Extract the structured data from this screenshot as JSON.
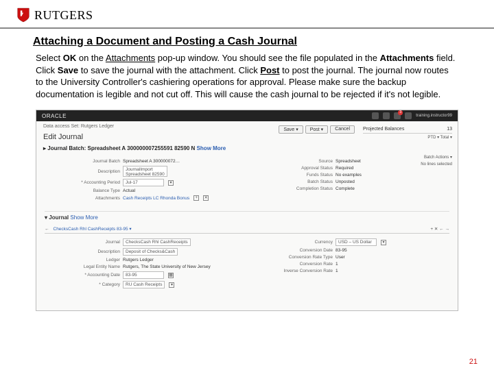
{
  "logo_text": "RUTGERS",
  "section_title": "Attaching a Document and Posting a Cash Journal",
  "p_pre1": "Select ",
  "p_ok": "OK",
  "p_mid1": " on the ",
  "p_attachments1": "Attachments",
  "p_mid2": " pop-up window. You should see the file populated in the ",
  "p_attachments2": "Attachments",
  "p_mid3": " field. Click ",
  "p_save": "Save",
  "p_mid4": " to save the journal with the attachment. Click ",
  "p_post": "Post",
  "p_after": " to post the journal. The journal now routes to the University Controller's cashiering operations for approval. Please make sure the backup documentation is legible and not cut off. This will cause the cash journal to be rejected if it's not legible.",
  "page_num": "21",
  "shot": {
    "brand": "ORACLE",
    "badge": "3",
    "user": "training.instructor99",
    "crumb": "Data access Set: Rutgers Ledger",
    "edit_title": "Edit Journal",
    "batch": "Journal Batch: Spreadsheet A 300000007255591 82590 N",
    "show_more": "Show More",
    "btn_save": "Save ▾",
    "btn_post": "Post ▾",
    "btn_cancel": "Cancel",
    "rp_title": "Projected Balances",
    "rp_count": "13",
    "rp_line1": "PTD ▾  Total ▾",
    "rp_batch_act": "Batch Actions ▾",
    "rp_no_lines": "No lines selected",
    "form": {
      "jb_label": "Journal Batch",
      "jb_value": "Spreadsheet A 300000072…",
      "desc_label": "Description",
      "desc_value": "JournalImport\nSpreadsheet 82590",
      "ap_label": "* Accounting Period",
      "ap_value": "Jul-17",
      "bt_label": "Balance Type",
      "bt_value": "Actual",
      "att_label": "Attachments",
      "att_value": "Cash Receipts LC Rhonda Bonus",
      "src_label": "Source",
      "src_value": "Spreadsheet",
      "appr_label": "Approval Status",
      "appr_value": "Required",
      "funds_label": "Funds Status",
      "funds_value": "No examples",
      "bs_label": "Batch Status",
      "bs_value": "Unposted",
      "cs_label": "Completion Status",
      "cs_value": "Complete"
    },
    "sub_header": "Journal",
    "sub_show": "Show More",
    "tab_line": "ChecksCash Rhl CashReceipts 83-95 ▾",
    "tab_icons": "+  ✕  ←  →",
    "lower": {
      "journal_label": "Journal",
      "journal_value": "ChecksCash Rhl CashReceipts",
      "desc_label": "Description",
      "desc_value": "Deposit of Checks&Cash",
      "ledger_label": "Ledger",
      "ledger_value": "Rutgers Ledger",
      "entity_label": "Legal Entity Name",
      "entity_value": "Rutgers, The State University of New Jersey",
      "adate_label": "* Accounting Date",
      "adate_value": "83-95",
      "cat_label": "* Category",
      "cat_value": "RU Cash Receipts",
      "curr_label": "Currency",
      "curr_value": "USD – US Dollar",
      "cdate_label": "Conversion Date",
      "cdate_value": "83-95",
      "crtype_label": "Conversion Rate Type",
      "crtype_value": "User",
      "crate_label": "Conversion Rate",
      "crate_value": "1",
      "icrate_label": "Inverse Conversion Rate",
      "icrate_value": "1"
    }
  }
}
